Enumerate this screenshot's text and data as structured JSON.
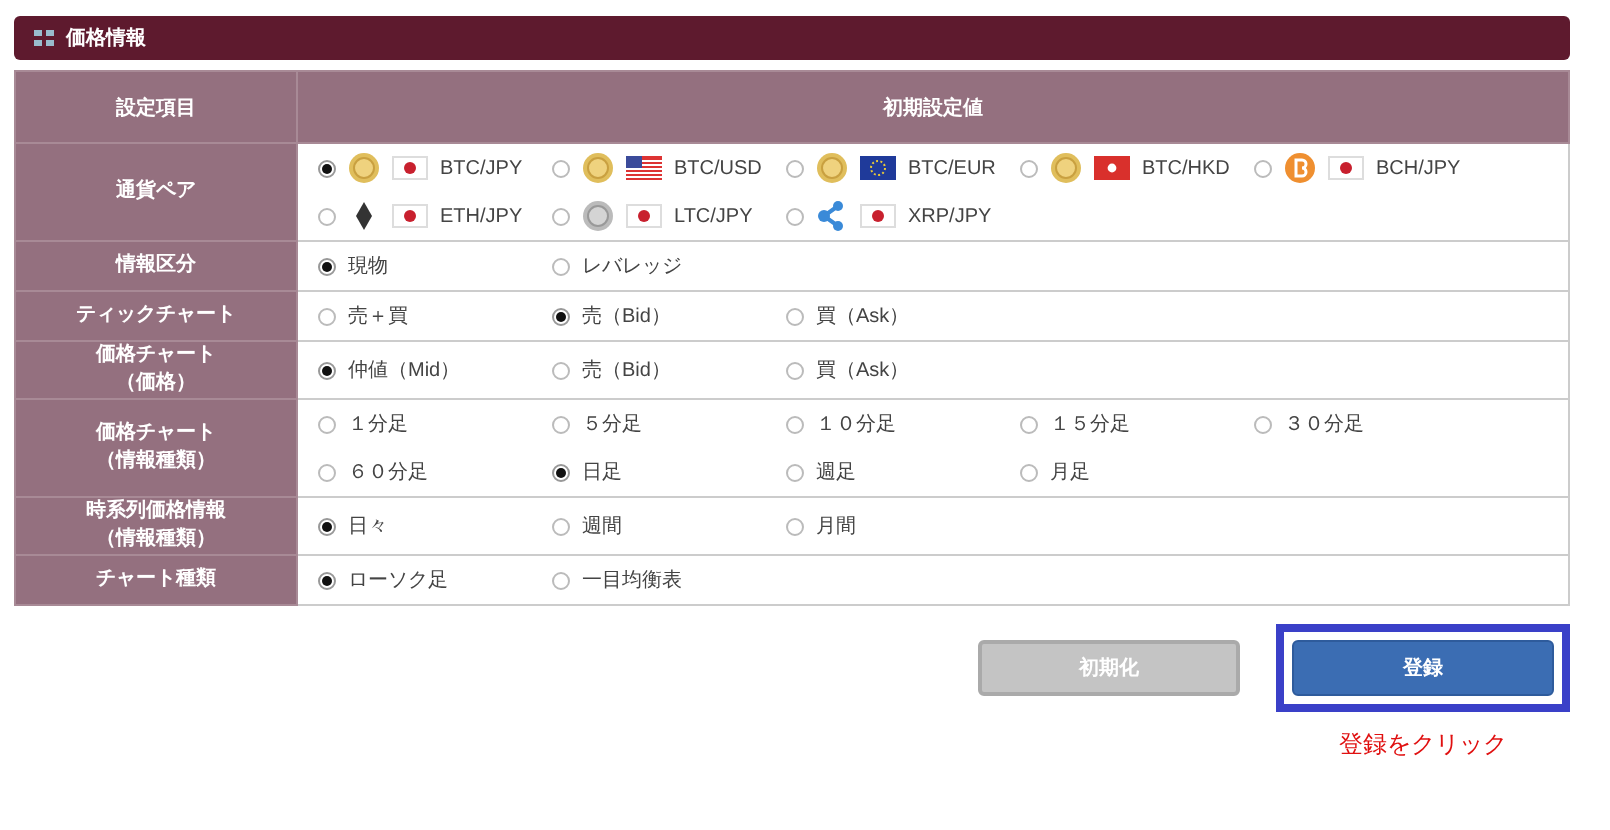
{
  "panel": {
    "title": "価格情報"
  },
  "table": {
    "columns": [
      "設定項目",
      "初期設定値"
    ],
    "rows": [
      {
        "label": "通貨ペア",
        "options": [
          {
            "label": "BTC/JPY",
            "selected": true,
            "kind": "gold-jp"
          },
          {
            "label": "BTC/USD",
            "selected": false,
            "kind": "gold-us"
          },
          {
            "label": "BTC/EUR",
            "selected": false,
            "kind": "gold-eu"
          },
          {
            "label": "BTC/HKD",
            "selected": false,
            "kind": "gold-hk"
          },
          {
            "label": "BCH/JPY",
            "selected": false,
            "kind": "orange-jp"
          },
          {
            "label": "ETH/JPY",
            "selected": false,
            "kind": "ether-jp"
          },
          {
            "label": "LTC/JPY",
            "selected": false,
            "kind": "silver-jp"
          },
          {
            "label": "XRP/JPY",
            "selected": false,
            "kind": "ripple-jp"
          }
        ]
      },
      {
        "label": "情報区分",
        "options": [
          {
            "label": "現物",
            "selected": true
          },
          {
            "label": "レバレッジ",
            "selected": false
          }
        ]
      },
      {
        "label": "ティックチャート",
        "options": [
          {
            "label": "売＋買",
            "selected": false
          },
          {
            "label": "売（Bid）",
            "selected": true
          },
          {
            "label": "買（Ask）",
            "selected": false
          }
        ]
      },
      {
        "label": "価格チャート",
        "sublabel": "（価格）",
        "options": [
          {
            "label": "仲値（Mid）",
            "selected": true
          },
          {
            "label": "売（Bid）",
            "selected": false
          },
          {
            "label": "買（Ask）",
            "selected": false
          }
        ]
      },
      {
        "label": "価格チャート",
        "sublabel": "（情報種類）",
        "options": [
          {
            "label": "１分足",
            "selected": false
          },
          {
            "label": "５分足",
            "selected": false
          },
          {
            "label": "１０分足",
            "selected": false
          },
          {
            "label": "１５分足",
            "selected": false
          },
          {
            "label": "３０分足",
            "selected": false
          },
          {
            "label": "６０分足",
            "selected": false
          },
          {
            "label": "日足",
            "selected": true
          },
          {
            "label": "週足",
            "selected": false
          },
          {
            "label": "月足",
            "selected": false
          }
        ]
      },
      {
        "label": "時系列価格情報",
        "sublabel": "（情報種類）",
        "options": [
          {
            "label": "日々",
            "selected": true
          },
          {
            "label": "週間",
            "selected": false
          },
          {
            "label": "月間",
            "selected": false
          }
        ]
      },
      {
        "label": "チャート種類",
        "options": [
          {
            "label": "ローソク足",
            "selected": true
          },
          {
            "label": "一目均衡表",
            "selected": false
          }
        ]
      }
    ]
  },
  "buttons": [
    {
      "label": "初期化",
      "kind": "reset"
    },
    {
      "label": "登録",
      "kind": "submit",
      "highlighted": true
    }
  ],
  "annotation": "登録をクリック"
}
